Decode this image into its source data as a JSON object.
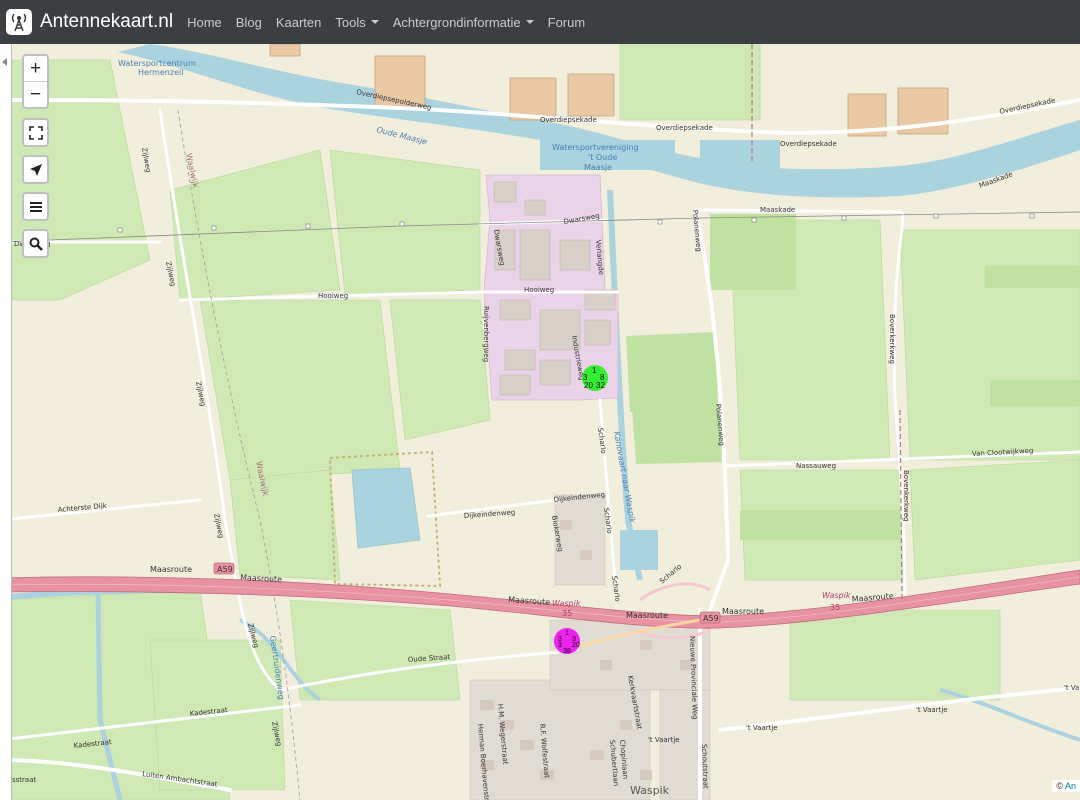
{
  "navbar": {
    "brand": "Antennekaart.nl",
    "brand_icon": "antenna-tower-icon",
    "items": [
      {
        "label": "Home"
      },
      {
        "label": "Blog"
      },
      {
        "label": "Kaarten"
      },
      {
        "label": "Tools",
        "dropdown": true
      },
      {
        "label": "Achtergrondinformatie",
        "dropdown": true
      },
      {
        "label": "Forum"
      }
    ]
  },
  "map_controls": {
    "zoom_in": "+",
    "zoom_out": "−",
    "fullscreen_icon": "fullscreen-icon",
    "locate_icon": "locate-arrow-icon",
    "layers_icon": "layers-menu-icon",
    "search_icon": "search-icon"
  },
  "map_labels": {
    "watersport_1": "Watersportcentrum",
    "watersport_2": "Hermenzeil",
    "overdiepsepolderweg": "Overdiepsepolderweg",
    "overdiepsekade_1": "Overdiepsekade",
    "overdiepsekade_2": "Overdiepsekade",
    "overdiepsekade_3": "Overdiepsekade",
    "overdiepsekade_4": "Overdiepsekade",
    "oude_maasje": "Oude Maasje",
    "wsv_1": "Watersportvereniging",
    "wsv_2": "'t Oude",
    "wsv_3": "Maasje",
    "maaskade_1": "Maaskade",
    "maaskade_2": "Maaskade",
    "dwarsweg_1": "Dwarsweg",
    "dwarsweg_2": "Dwarsweg",
    "dwarsweg_3": "Dwarsweg",
    "verlengde": "Verlangde",
    "hooiweg_1": "Hooiweg",
    "hooiweg_2": "Hooiweg",
    "ruijvenbergweg": "Ruijvenbergweg",
    "industrieweg": "Industrieweg",
    "polanenweg_1": "Polanenweg",
    "polanenweg_2": "Polanenweg",
    "boverkerkweg": "Boverkerkweg",
    "bovenkerkweg": "Bovenkerkweg",
    "zijlweg_1": "Zijlweg",
    "zijlweg_2": "Zijlweg",
    "zijlweg_3": "Zijlweg",
    "zijlweg_4": "Zijlweg",
    "zijlweg_5": "Zijlweg",
    "zijlweg_6": "Zijlweg",
    "waalwijk_1": "Waalwijk",
    "waalwijk_2": "Waalwijk",
    "nassauweg": "Nassauweg",
    "van_clootwijkweg": "Van Clootwijkweg",
    "achterste_dijk": "Achterste Dijk",
    "dijkeindenweg_1": "Dijkeindenweg",
    "dijkeindenweg_2": "Dijkeindenweg",
    "biokerweg": "Biokerweg",
    "scharlo_1": "Scharlo",
    "scharlo_2": "Scharlo",
    "scharlo_3": "Scharlo",
    "scharlo_4": "Scharlo",
    "kanovaart": "Kanovaart naar Waspik",
    "maasroute_1": "Maasroute",
    "maasroute_2": "Maasroute",
    "maasroute_3": "Maasroute",
    "maasroute_4": "Maasroute",
    "maasroute_5": "Maasroute",
    "maasroute_6": "Maasroute",
    "a59_1": "A59",
    "a59_2": "A59",
    "waspik_exit_1": "Waspik",
    "waspik_exit_2": "35",
    "waspik_exit_3": "Waspik",
    "waspik_exit_4": "35",
    "geertruidenweg": "Geertruidenweg",
    "oude_straat": "Oude Straat",
    "kadestraat_1": "Kadestraat",
    "kadestraat_2": "Kadestraat",
    "kadestraat_3": "sstraat",
    "luiten": "Luiten Ambachtstraat",
    "neuwe_prov": "Nieuwe Provinciale Weg",
    "t_vaartje_1": "'t Vaartje",
    "t_vaartje_2": "'t Vaartje",
    "t_vaartje_3": "'t Vaartje",
    "t_vaartje_4": "'t Va",
    "schoutstraat": "Schoutstraat",
    "waspik": "Waspik",
    "weigerstraat": "H.M. Wegerstraat",
    "boerhavenstraat": "Herman Boerhavenstraat",
    "wolfestraat": "R.F. Wolfestraat",
    "kerkvaartstraat": "Kerkvaartstraat",
    "chopinlaan": "Chopinlaan",
    "schubertlaan": "Schubertlaan"
  },
  "clusters": {
    "green": {
      "color": "#33ee33",
      "n1": "1",
      "n2": "3",
      "n3": "8",
      "n4": "20",
      "n5": "32"
    },
    "magenta": {
      "color": "#ee22ee",
      "n1": "1",
      "n2": "3",
      "n3": "3",
      "n4": "3",
      "n5": "20",
      "n6": "38"
    }
  },
  "attribution": {
    "prefix": "©",
    "text": "An"
  }
}
